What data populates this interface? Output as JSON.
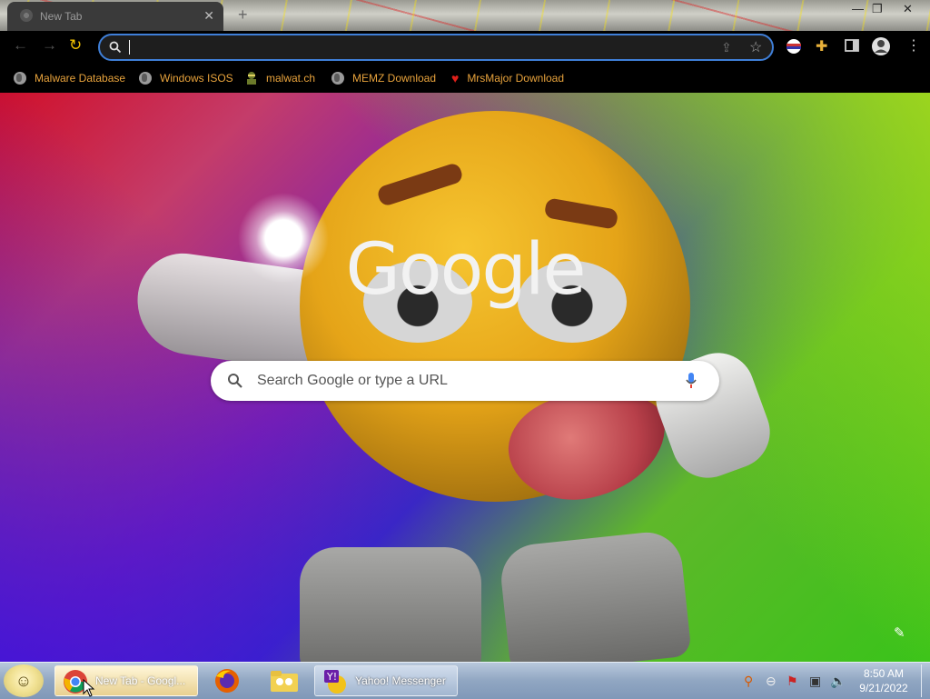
{
  "browser": {
    "tab": {
      "title": "New Tab",
      "close": "✕"
    },
    "new_tab": "+",
    "window_controls": [
      "—",
      "❐",
      "✕"
    ],
    "omnibox": {
      "value": "",
      "placeholder": ""
    },
    "bookmarks": [
      {
        "label": "Malware Database",
        "icon": "globe-icon"
      },
      {
        "label": "Windows ISOS",
        "icon": "globe-icon"
      },
      {
        "label": "malwat.ch",
        "icon": "ninja-icon"
      },
      {
        "label": "MEMZ Download",
        "icon": "globe-icon"
      },
      {
        "label": "MrsMajor Download",
        "icon": "heart-icon"
      }
    ]
  },
  "ntp": {
    "logo": "Google",
    "search_placeholder": "Search Google or type a URL"
  },
  "taskbar": {
    "buttons": [
      {
        "label": "New Tab - Googl...",
        "icon": "chrome-icon",
        "active": true
      },
      {
        "label": "",
        "icon": "firefox-icon"
      },
      {
        "label": "",
        "icon": "folder-icon"
      },
      {
        "label": "Yahoo! Messenger",
        "icon": "yahoo-icon"
      }
    ],
    "clock": {
      "time": "8:50 AM",
      "date": "9/21/2022"
    }
  },
  "colors": {
    "bookmark_text": "#e8a33c",
    "omnibox_border": "#3f7fd8",
    "toolbar_bg": "#000000",
    "mic_blue": "#4285f4"
  }
}
